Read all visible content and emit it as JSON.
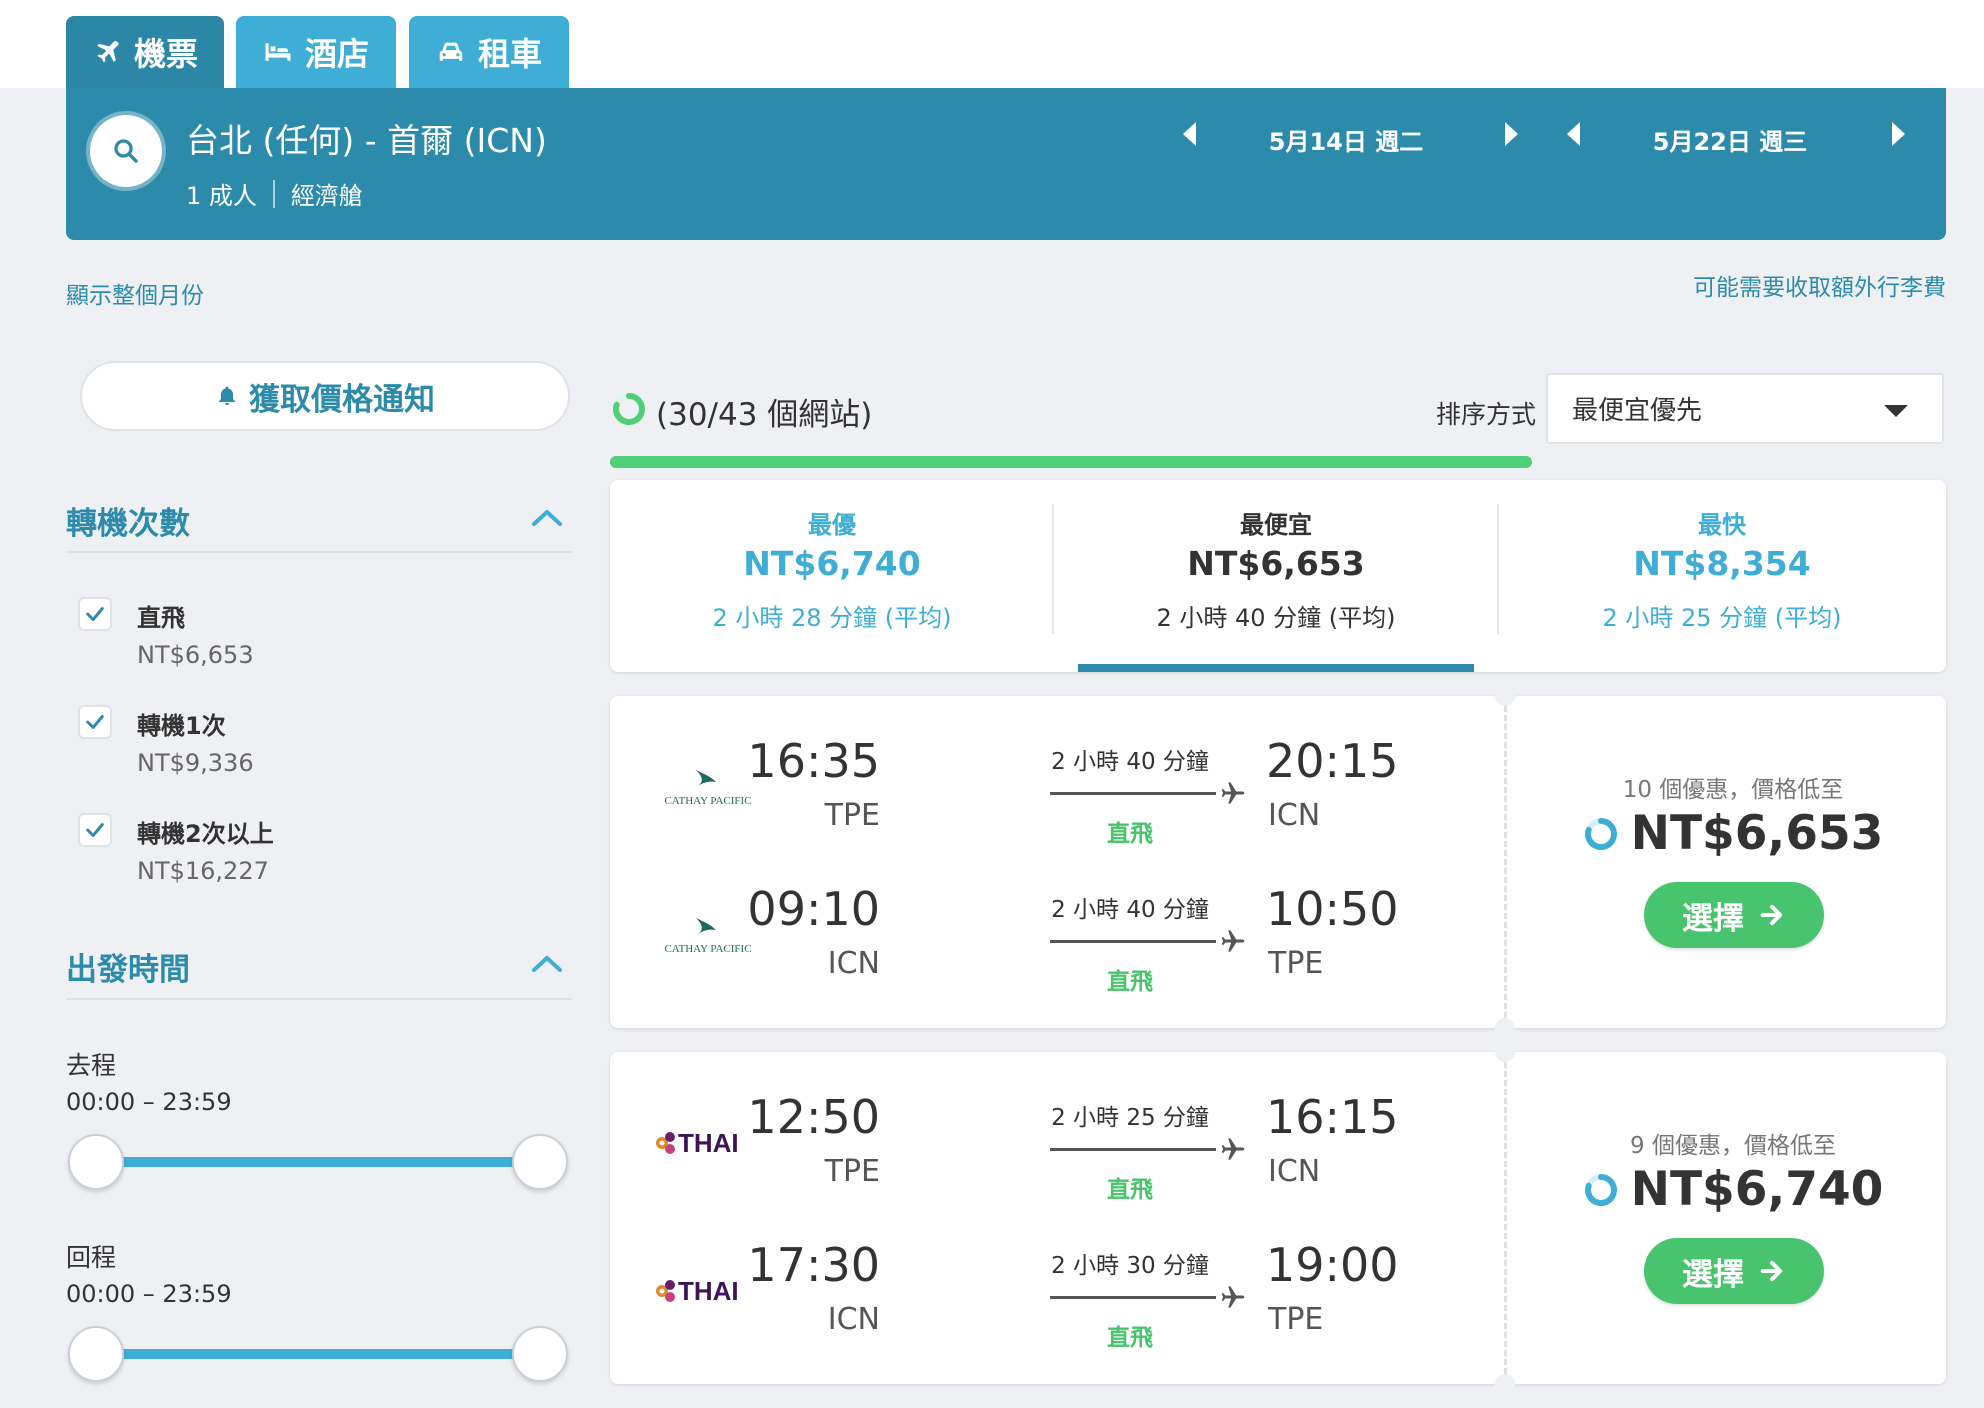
{
  "tabs": [
    {
      "label": "機票",
      "icon": "plane-icon"
    },
    {
      "label": "酒店",
      "icon": "bed-icon"
    },
    {
      "label": "租車",
      "icon": "car-icon"
    }
  ],
  "search": {
    "route": "台北 (任何) - 首爾 (ICN)",
    "passengers": "1 成人",
    "cabin": "經濟艙",
    "depart_date": "5月14日 週二",
    "return_date": "5月22日 週三"
  },
  "links": {
    "show_month": "顯示整個月份",
    "baggage_note": "可能需要收取額外行李費"
  },
  "price_alert_label": "獲取價格通知",
  "filters": {
    "stops_title": "轉機次數",
    "stops": [
      {
        "label": "直飛",
        "price": "NT$6,653",
        "checked": true
      },
      {
        "label": "轉機1次",
        "price": "NT$9,336",
        "checked": true
      },
      {
        "label": "轉機2次以上",
        "price": "NT$16,227",
        "checked": true
      }
    ],
    "time_title": "出發時間",
    "outbound_label": "去程",
    "outbound_range": "00:00 – 23:59",
    "return_label": "回程",
    "return_range": "00:00 – 23:59"
  },
  "results": {
    "sites_progress": "(30/43 個網站)",
    "sort_label": "排序方式",
    "sort_value": "最便宜優先",
    "summary": [
      {
        "label": "最優",
        "price": "NT$6,740",
        "duration": "2 小時 28 分鐘 (平均)"
      },
      {
        "label": "最便宜",
        "price": "NT$6,653",
        "duration": "2 小時 40 分鐘 (平均)"
      },
      {
        "label": "最快",
        "price": "NT$8,354",
        "duration": "2 小時 25 分鐘 (平均)"
      }
    ],
    "flights": [
      {
        "airline": "CATHAY PACIFIC",
        "legs": [
          {
            "dep_time": "16:35",
            "dep_code": "TPE",
            "duration": "2 小時 40 分鐘",
            "stops": "直飛",
            "arr_time": "20:15",
            "arr_code": "ICN"
          },
          {
            "dep_time": "09:10",
            "dep_code": "ICN",
            "duration": "2 小時 40 分鐘",
            "stops": "直飛",
            "arr_time": "10:50",
            "arr_code": "TPE"
          }
        ],
        "deals": "10 個優惠，價格低至",
        "price": "NT$6,653",
        "select_label": "選擇"
      },
      {
        "airline": "THAI",
        "legs": [
          {
            "dep_time": "12:50",
            "dep_code": "TPE",
            "duration": "2 小時 25 分鐘",
            "stops": "直飛",
            "arr_time": "16:15",
            "arr_code": "ICN"
          },
          {
            "dep_time": "17:30",
            "dep_code": "ICN",
            "duration": "2 小時 30 分鐘",
            "stops": "直飛",
            "arr_time": "19:00",
            "arr_code": "TPE"
          }
        ],
        "deals": "9 個優惠，價格低至",
        "price": "NT$6,740",
        "select_label": "選擇"
      }
    ]
  },
  "colors": {
    "primary": "#2c8bab",
    "tab_inactive": "#3eaed6",
    "accent_green": "#49c46e",
    "progress_green": "#4fcf78",
    "background": "#eef0f3"
  }
}
